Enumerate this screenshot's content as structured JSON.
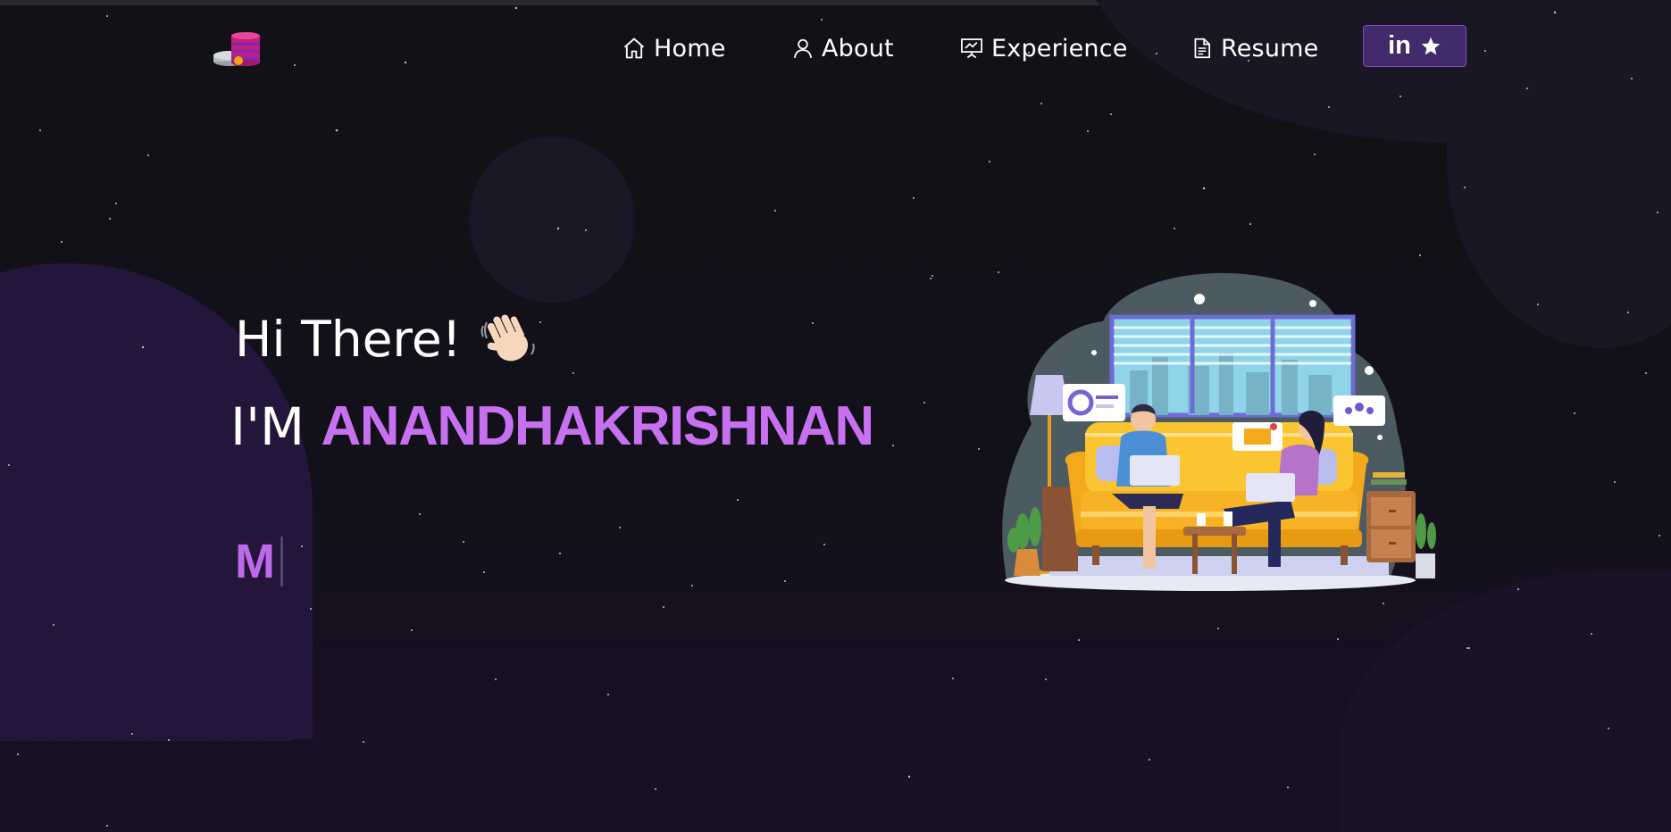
{
  "navbar": {
    "logo_icon": "database-coins-logo",
    "items": [
      {
        "label": "Home",
        "icon": "home-icon"
      },
      {
        "label": "About",
        "icon": "user-icon"
      },
      {
        "label": "Experience",
        "icon": "presentation-icon"
      },
      {
        "label": "Resume",
        "icon": "document-icon"
      }
    ],
    "button": {
      "text": "in",
      "icons": [
        "linkedin-icon",
        "star-icon"
      ]
    }
  },
  "hero": {
    "greeting": "Hi There!",
    "greeting_emoji": "waving-hand",
    "name_prefix": "I'M",
    "name": "ANANDHAKRISHNAN",
    "typed_text": "M"
  },
  "colors": {
    "background": "#121118",
    "accent": "#c770f0",
    "button_bg": "#432a6a",
    "blob": "#24153a"
  }
}
